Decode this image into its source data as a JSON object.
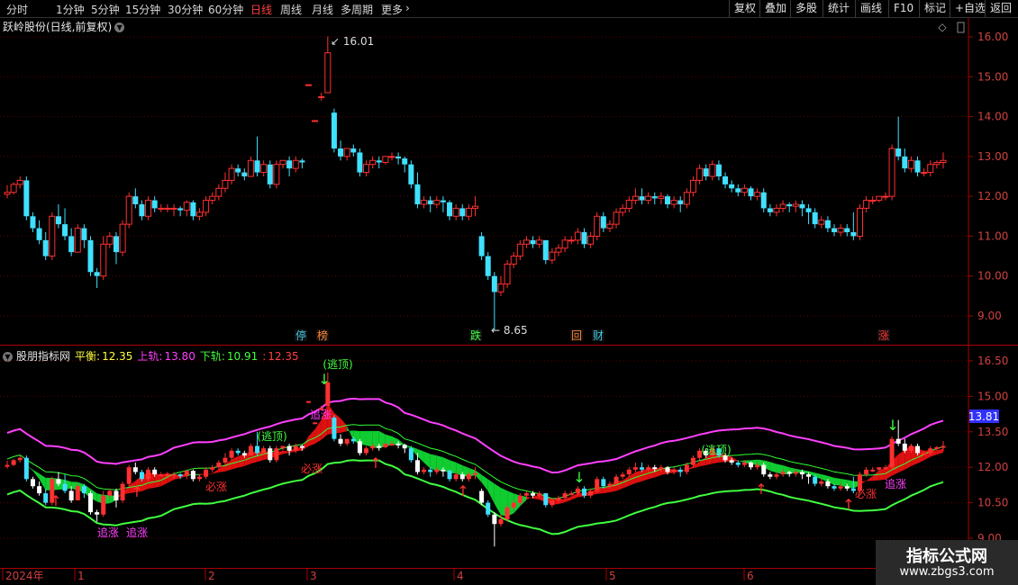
{
  "toolbar": {
    "periods": [
      "分时",
      "1分钟",
      "5分钟",
      "15分钟",
      "30分钟",
      "60分钟",
      "日线",
      "周线",
      "月线",
      "多周期",
      "更多"
    ],
    "active_period": "日线",
    "more_icon": "chevron-right-icon",
    "right_buttons": [
      "复权",
      "叠加",
      "多股",
      "统计",
      "画线",
      "F10",
      "标记",
      "+自选",
      "返回"
    ]
  },
  "main_panel": {
    "title": "跃岭股份(日线,前复权)",
    "title_icon": "chevron-down-icon",
    "right_icons": [
      "diamond-icon",
      "scroll-icon"
    ],
    "high_label": "16.01",
    "low_label": "8.65",
    "event_markers": [
      {
        "text": "停",
        "color": "#40c8e0"
      },
      {
        "text": "榜",
        "color": "#ff8030"
      },
      {
        "text": "跌",
        "color": "#40ff40"
      },
      {
        "text": "回",
        "color": "#ff8030"
      },
      {
        "text": "财",
        "color": "#40c8e0"
      },
      {
        "text": "涨",
        "color": "#ff3030"
      }
    ]
  },
  "indicator_panel": {
    "name": "股朋指标网",
    "items": [
      {
        "label": "平衡:",
        "value": "12.35",
        "color": "#ffff40"
      },
      {
        "label": "上轨:",
        "value": "13.80",
        "color": "#ff40ff"
      },
      {
        "label": "下轨:",
        "value": "10.91",
        "color": "#40ff40"
      },
      {
        "label": ":",
        "value": "12.35",
        "color": "#ff4040"
      }
    ],
    "current_tag": "13.81",
    "annotations": [
      "(逃顶)",
      "追涨",
      "必涨",
      "(逃顶)",
      "追涨",
      "追涨",
      "必涨",
      "(逃顶)",
      "追涨",
      "必涨"
    ]
  },
  "axes": {
    "price_ticks": [
      "16.00",
      "15.00",
      "14.00",
      "13.00",
      "12.00",
      "11.00",
      "10.00",
      "9.00"
    ],
    "indicator_ticks": [
      "16.50",
      "15.00",
      "13.50",
      "12.00",
      "10.50",
      "9.00"
    ],
    "date_labels": [
      "2024年",
      "1",
      "2",
      "3",
      "4",
      "5",
      "6"
    ]
  },
  "colors": {
    "up": "#ff3030",
    "down": "#40e0ff",
    "upper": "#ff40ff",
    "lower": "#40ff40",
    "grid": "#5a0000"
  },
  "watermark": {
    "line1": "指标公式网",
    "line2": "www.zbgs3.com"
  },
  "chart_data": {
    "type": "candlestick",
    "series": [
      {
        "values": [
          [
            12.05,
            12.28,
            12.1,
            11.95
          ],
          [
            12.1,
            12.35,
            12.3,
            12.05
          ],
          [
            12.3,
            12.5,
            12.4,
            12.2
          ],
          [
            12.4,
            12.5,
            11.5,
            11.4
          ],
          [
            11.5,
            11.6,
            11.2,
            11.1
          ],
          [
            11.2,
            11.4,
            10.9,
            10.8
          ],
          [
            10.9,
            11.1,
            10.5,
            10.4
          ],
          [
            10.5,
            11.6,
            11.5,
            10.4
          ],
          [
            11.5,
            11.8,
            11.3,
            11.2
          ],
          [
            11.3,
            11.7,
            11.0,
            10.9
          ],
          [
            11.0,
            11.2,
            10.6,
            10.5
          ],
          [
            10.6,
            11.3,
            11.2,
            10.6
          ],
          [
            11.2,
            11.3,
            10.9,
            10.7
          ],
          [
            10.9,
            11.0,
            10.1,
            10.0
          ],
          [
            10.1,
            10.2,
            10.0,
            9.7
          ],
          [
            10.0,
            11.0,
            10.8,
            9.9
          ],
          [
            10.8,
            11.1,
            11.0,
            10.7
          ],
          [
            11.0,
            11.1,
            10.6,
            10.3
          ],
          [
            10.6,
            11.4,
            11.3,
            10.5
          ],
          [
            11.3,
            12.1,
            12.0,
            11.2
          ],
          [
            12.0,
            12.2,
            11.8,
            11.7
          ],
          [
            11.8,
            11.9,
            11.5,
            11.4
          ],
          [
            11.5,
            12.0,
            11.9,
            11.4
          ],
          [
            11.9,
            12.0,
            11.7,
            11.6
          ],
          [
            11.7,
            11.8,
            11.7,
            11.6
          ],
          [
            11.7,
            11.8,
            11.7,
            11.6
          ],
          [
            11.7,
            11.8,
            11.7,
            11.5
          ],
          [
            11.7,
            11.75,
            11.65,
            11.5
          ],
          [
            11.65,
            11.9,
            11.85,
            11.5
          ],
          [
            11.85,
            11.9,
            11.5,
            11.4
          ],
          [
            11.5,
            11.7,
            11.6,
            11.4
          ],
          [
            11.6,
            12.0,
            11.9,
            11.5
          ],
          [
            11.9,
            12.1,
            12.0,
            11.8
          ],
          [
            12.0,
            12.3,
            12.2,
            11.9
          ],
          [
            12.2,
            12.6,
            12.4,
            12.1
          ],
          [
            12.4,
            12.8,
            12.7,
            12.3
          ],
          [
            12.7,
            12.8,
            12.6,
            12.5
          ],
          [
            12.6,
            12.7,
            12.5,
            12.4
          ],
          [
            12.5,
            13.0,
            12.9,
            12.5
          ],
          [
            12.9,
            13.5,
            12.6,
            12.5
          ],
          [
            12.6,
            12.9,
            12.8,
            12.5
          ],
          [
            12.8,
            12.9,
            12.3,
            12.2
          ],
          [
            12.3,
            12.9,
            12.8,
            12.2
          ],
          [
            12.8,
            12.9,
            12.9,
            12.7
          ],
          [
            12.9,
            13.0,
            12.7,
            12.5
          ],
          [
            12.7,
            13.0,
            12.9,
            12.6
          ],
          [
            12.9,
            12.95,
            12.85,
            12.7
          ],
          [
            14.8,
            14.8,
            14.8,
            14.8
          ],
          [
            13.9,
            13.9,
            13.9,
            13.9
          ],
          [
            14.5,
            14.6,
            14.5,
            14.4
          ],
          [
            14.6,
            16.01,
            15.6,
            14.6
          ],
          [
            14.1,
            14.2,
            13.2,
            13.1
          ],
          [
            13.2,
            13.4,
            13.0,
            12.9
          ],
          [
            13.0,
            13.2,
            13.2,
            12.9
          ],
          [
            13.2,
            13.3,
            13.1,
            13.0
          ],
          [
            13.1,
            13.2,
            12.6,
            12.5
          ],
          [
            12.6,
            12.9,
            12.8,
            12.5
          ],
          [
            12.8,
            13.0,
            12.9,
            12.7
          ],
          [
            12.9,
            13.0,
            12.85,
            12.7
          ],
          [
            12.85,
            13.0,
            13.0,
            12.8
          ],
          [
            13.0,
            13.1,
            13.0,
            12.9
          ],
          [
            13.0,
            13.1,
            12.95,
            12.8
          ],
          [
            12.95,
            13.0,
            12.8,
            12.6
          ],
          [
            12.8,
            12.9,
            12.3,
            12.2
          ],
          [
            12.3,
            12.6,
            11.8,
            11.7
          ],
          [
            11.8,
            12.0,
            11.9,
            11.7
          ],
          [
            11.9,
            12.0,
            11.8,
            11.6
          ],
          [
            11.8,
            12.0,
            11.9,
            11.7
          ],
          [
            11.9,
            12.0,
            11.85,
            11.6
          ],
          [
            11.85,
            11.9,
            11.5,
            11.4
          ],
          [
            11.5,
            11.8,
            11.7,
            11.4
          ],
          [
            11.7,
            11.8,
            11.5,
            11.4
          ],
          [
            11.5,
            11.8,
            11.7,
            11.4
          ],
          [
            11.7,
            12.0,
            11.75,
            11.5
          ],
          [
            11.0,
            11.1,
            10.5,
            10.4
          ],
          [
            10.5,
            10.6,
            10.0,
            9.9
          ],
          [
            10.0,
            10.1,
            9.6,
            8.65
          ],
          [
            9.6,
            10.0,
            9.8,
            9.5
          ],
          [
            9.8,
            10.4,
            10.3,
            9.7
          ],
          [
            10.3,
            10.6,
            10.5,
            10.2
          ],
          [
            10.5,
            10.9,
            10.8,
            10.4
          ],
          [
            10.8,
            11.0,
            10.9,
            10.7
          ],
          [
            10.9,
            11.0,
            10.8,
            10.7
          ],
          [
            10.8,
            11.0,
            10.9,
            10.7
          ],
          [
            10.9,
            10.9,
            10.4,
            10.3
          ],
          [
            10.4,
            10.7,
            10.6,
            10.3
          ],
          [
            10.6,
            10.8,
            10.7,
            10.5
          ],
          [
            10.7,
            11.0,
            10.9,
            10.6
          ],
          [
            10.9,
            11.0,
            10.9,
            10.8
          ],
          [
            10.9,
            11.2,
            11.1,
            10.8
          ],
          [
            11.1,
            11.2,
            10.8,
            10.7
          ],
          [
            10.8,
            11.1,
            11.0,
            10.7
          ],
          [
            11.0,
            11.6,
            11.5,
            10.9
          ],
          [
            11.5,
            11.6,
            11.2,
            11.1
          ],
          [
            11.2,
            11.4,
            11.3,
            11.1
          ],
          [
            11.3,
            11.7,
            11.6,
            11.2
          ],
          [
            11.6,
            11.8,
            11.7,
            11.5
          ],
          [
            11.7,
            12.0,
            11.9,
            11.6
          ],
          [
            11.9,
            12.2,
            12.0,
            11.8
          ],
          [
            12.0,
            12.2,
            11.9,
            11.8
          ],
          [
            11.9,
            12.1,
            12.0,
            11.8
          ],
          [
            12.0,
            12.1,
            11.95,
            11.8
          ],
          [
            11.95,
            12.1,
            12.0,
            11.8
          ],
          [
            12.0,
            12.05,
            11.8,
            11.7
          ],
          [
            11.8,
            12.0,
            11.9,
            11.7
          ],
          [
            11.9,
            12.0,
            11.8,
            11.6
          ],
          [
            11.8,
            12.2,
            12.1,
            11.7
          ],
          [
            12.1,
            12.5,
            12.4,
            12.0
          ],
          [
            12.4,
            12.8,
            12.7,
            12.3
          ],
          [
            12.7,
            12.8,
            12.5,
            12.4
          ],
          [
            12.5,
            12.9,
            12.8,
            12.4
          ],
          [
            12.8,
            12.9,
            12.5,
            12.4
          ],
          [
            12.5,
            12.6,
            12.3,
            12.2
          ],
          [
            12.3,
            12.4,
            12.2,
            12.1
          ],
          [
            12.2,
            12.3,
            12.1,
            12.0
          ],
          [
            12.1,
            12.3,
            12.2,
            12.0
          ],
          [
            12.2,
            12.25,
            12.0,
            11.9
          ],
          [
            12.0,
            12.2,
            12.1,
            11.9
          ],
          [
            12.1,
            12.2,
            11.7,
            11.6
          ],
          [
            11.7,
            11.8,
            11.6,
            11.5
          ],
          [
            11.6,
            11.8,
            11.7,
            11.5
          ],
          [
            11.7,
            11.9,
            11.8,
            11.6
          ],
          [
            11.8,
            11.85,
            11.75,
            11.6
          ],
          [
            11.75,
            11.9,
            11.8,
            11.6
          ],
          [
            11.8,
            11.9,
            11.7,
            11.5
          ],
          [
            11.7,
            11.8,
            11.6,
            11.3
          ],
          [
            11.6,
            11.7,
            11.3,
            11.2
          ],
          [
            11.3,
            11.5,
            11.4,
            11.2
          ],
          [
            11.4,
            11.5,
            11.2,
            11.1
          ],
          [
            11.2,
            11.3,
            11.1,
            11.0
          ],
          [
            11.1,
            11.3,
            11.2,
            11.0
          ],
          [
            11.2,
            11.3,
            11.1,
            11.0
          ],
          [
            11.1,
            11.6,
            11.0,
            10.9
          ],
          [
            11.0,
            11.8,
            11.7,
            10.9
          ],
          [
            11.7,
            12.0,
            11.9,
            11.6
          ],
          [
            11.9,
            12.0,
            11.9,
            11.8
          ],
          [
            11.9,
            12.0,
            12.0,
            11.85
          ],
          [
            12.0,
            12.1,
            12.0,
            11.9
          ],
          [
            12.0,
            13.3,
            13.2,
            11.9
          ],
          [
            13.2,
            14.0,
            13.0,
            12.9
          ],
          [
            13.0,
            13.2,
            12.7,
            12.6
          ],
          [
            12.7,
            13.0,
            12.9,
            12.6
          ],
          [
            12.9,
            13.0,
            12.6,
            12.5
          ],
          [
            12.6,
            12.7,
            12.6,
            12.5
          ],
          [
            12.6,
            12.9,
            12.8,
            12.5
          ],
          [
            12.8,
            12.9,
            12.85,
            12.7
          ],
          [
            12.85,
            13.1,
            12.9,
            12.7
          ]
        ]
      }
    ],
    "x": [
      "2024年",
      "1",
      "2",
      "3",
      "4",
      "5",
      "6"
    ],
    "ylim": [
      8.5,
      16.3
    ]
  }
}
